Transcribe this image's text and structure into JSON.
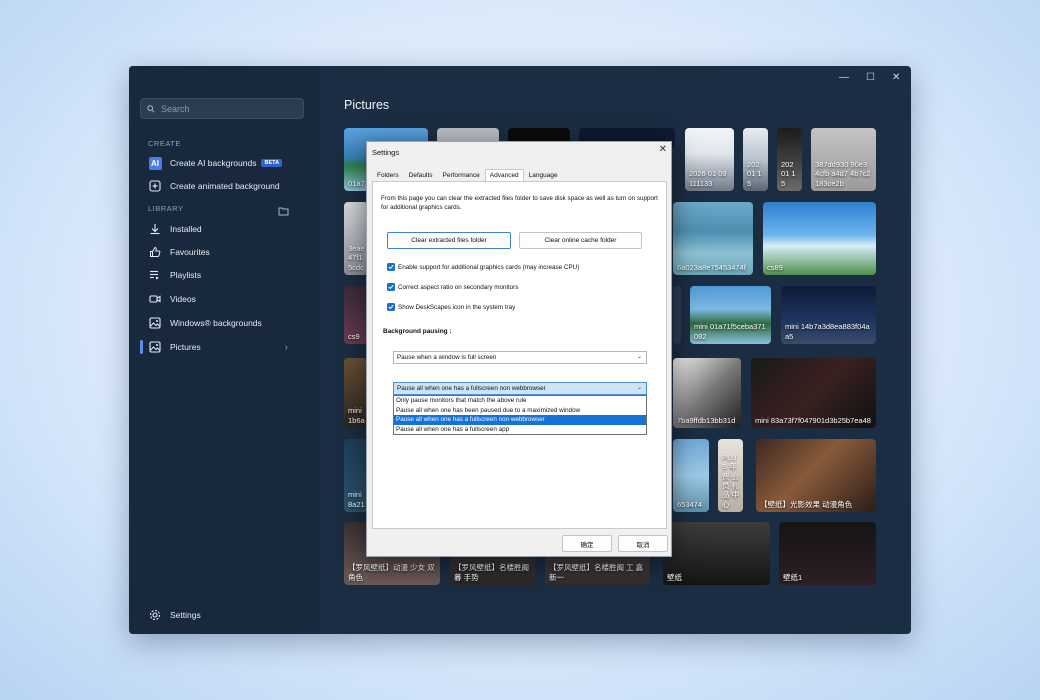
{
  "sidebar": {
    "search_placeholder": "Search",
    "create_label": "CREATE",
    "create_items": [
      {
        "label": "Create AI backgrounds",
        "badge": "BETA",
        "icon": "ai-icon"
      },
      {
        "label": "Create animated background",
        "icon": "plus-square-icon"
      }
    ],
    "library_label": "LIBRARY",
    "library_items": [
      {
        "label": "Installed",
        "icon": "download-icon"
      },
      {
        "label": "Favourites",
        "icon": "thumbs-up-icon"
      },
      {
        "label": "Playlists",
        "icon": "playlist-icon"
      },
      {
        "label": "Videos",
        "icon": "video-icon"
      },
      {
        "label": "Windows® backgrounds",
        "icon": "image-icon"
      },
      {
        "label": "Pictures",
        "icon": "image-icon",
        "active": true
      }
    ],
    "settings_label": "Settings"
  },
  "main": {
    "title": "Pictures",
    "window_controls": [
      "—",
      "☐",
      "✕"
    ],
    "tiles": [
      {
        "caption": "01a7"
      },
      {
        "caption": ""
      },
      {
        "caption": ""
      },
      {
        "caption": ""
      },
      {
        "caption": "2026 01 09 111133"
      },
      {
        "caption": "202 01 15"
      },
      {
        "caption": "202 01 15"
      },
      {
        "caption": "387dd930 90e3 4cfb a4d7 4b7c2183ce2b"
      },
      {
        "caption": "3eae 47f1 5cdc"
      },
      {
        "caption": "6a023a8e75453474f"
      },
      {
        "caption": "cs89"
      },
      {
        "caption": "cs9"
      },
      {
        "caption": ""
      },
      {
        "caption": "mini 01a71f5ceba371082"
      },
      {
        "caption": "mini 14b7a3d8ea883f04aa5"
      },
      {
        "caption": "mini 1b6a"
      },
      {
        "caption": "7ba9ffdb13bb31d"
      },
      {
        "caption": "mini 83a73f7f047901d3b25b7ea48"
      },
      {
        "caption": "mini 8a21"
      },
      {
        "caption": "653474"
      },
      {
        "caption": "PLUS 年费 会员 礼品 中心"
      },
      {
        "caption": "【壁纸】光影效果 动漫角色"
      },
      {
        "caption": "【罗风壁纸】动漫 少女 双角色"
      },
      {
        "caption": "【罗风壁纸】名楼胜阁 暮 手势"
      },
      {
        "caption": "【罗风壁纸】名楼胜阁 工 嘉新一"
      },
      {
        "caption": "壁纸"
      },
      {
        "caption": "壁纸1"
      }
    ]
  },
  "dialog": {
    "title": "Settings",
    "close": "✕",
    "tabs": [
      "Folders",
      "Defaults",
      "Performance",
      "Advanced",
      "Language"
    ],
    "active_tab": "Advanced",
    "description": "From this page you can clear the extracted files folder to save disk space as well as turn on support for additional graphics cards.",
    "btn_clear_extracted": "Clear extracted files folder",
    "btn_clear_cache": "Clear online cache folder",
    "checkboxes": [
      "Enable support for additional graphics cards (may increase CPU)",
      "Correct aspect ratio on secondary monitors",
      "Show DeskScapes icon in the system tray"
    ],
    "bg_pausing_label": "Background pausing :",
    "select1_value": "Pause when a window is full screen",
    "select2_value": "Pause all when one has a fullscreen non webbrowser",
    "dropdown_options": [
      "Only pause monitors that match the above rule",
      "Pause all when one has been paused due to a maximized window",
      "Pause all when one has a fullscreen non webbrowser",
      "Pause all when one has a fullscreen app"
    ],
    "selected_option_index": 2,
    "ok_label": "确定",
    "cancel_label": "取消"
  }
}
